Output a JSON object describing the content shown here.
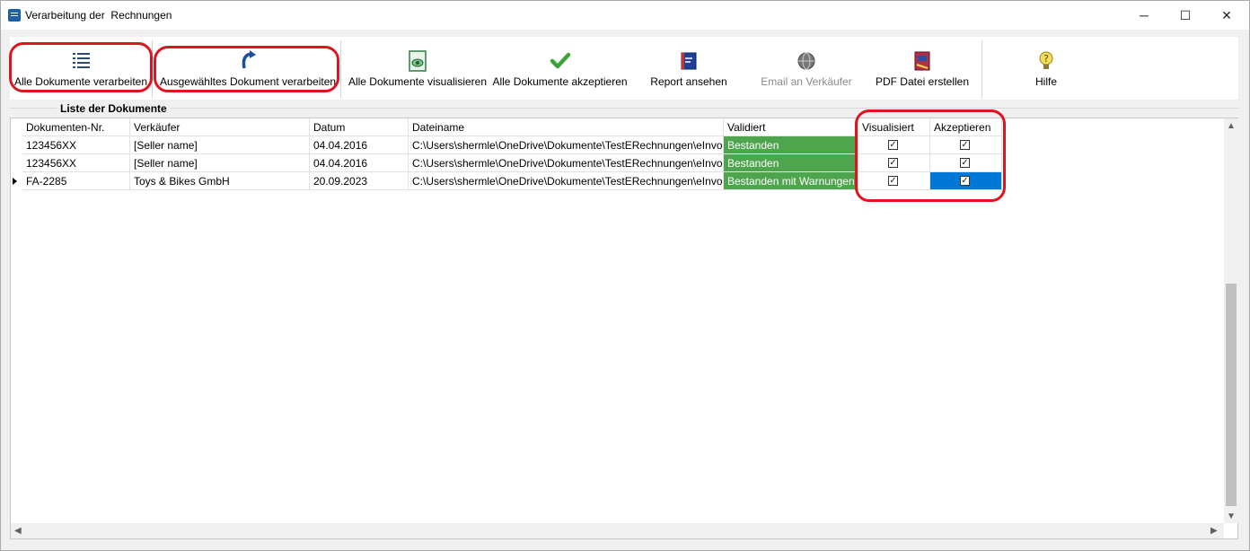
{
  "window": {
    "title": "Verarbeitung der  Rechnungen",
    "minimize": "─",
    "maximize": "☐",
    "close": "✕"
  },
  "toolbar": {
    "process_all": "Alle Dokumente verarbeiten",
    "process_selected": "Ausgewähltes Dokument verarbeiten",
    "visualize_all": "Alle Dokumente visualisieren",
    "accept_all": "Alle Dokumente akzeptieren",
    "report": "Report ansehen",
    "email": "Email an Verkäufer",
    "pdf": "PDF Datei erstellen",
    "help": "Hilfe"
  },
  "group": {
    "label": "Liste der Dokumente"
  },
  "columns": [
    "Dokumenten-Nr.",
    "Verkäufer",
    "Datum",
    "Dateiname",
    "Validiert",
    "Visualisiert",
    "Akzeptieren"
  ],
  "rows": [
    {
      "nr": "123456XX",
      "seller": "[Seller name]",
      "date": "04.04.2016",
      "file": "C:\\Users\\shermle\\OneDrive\\Dokumente\\TestERechnungen\\eInvoi",
      "valid": "Bestanden",
      "visualized": true,
      "accept": true
    },
    {
      "nr": "123456XX",
      "seller": "[Seller name]",
      "date": "04.04.2016",
      "file": "C:\\Users\\shermle\\OneDrive\\Dokumente\\TestERechnungen\\eInvoi",
      "valid": "Bestanden",
      "visualized": true,
      "accept": true
    },
    {
      "nr": "FA-2285",
      "seller": "Toys & Bikes GmbH",
      "date": "20.09.2023",
      "file": "C:\\Users\\shermle\\OneDrive\\Dokumente\\TestERechnungen\\eInvoi",
      "valid": "Bestanden mit Warnungen",
      "visualized": true,
      "accept": true
    }
  ],
  "icons": {
    "process_all": "list-icon",
    "process_selected": "curved-arrow-icon",
    "visualize_all": "eye-document-icon",
    "accept_all": "checkmark-icon",
    "report": "report-book-icon",
    "email": "globe-icon",
    "pdf": "pdf-icon",
    "help": "question-bulb-icon"
  },
  "colors": {
    "validated_ok": "#4ea54d",
    "selection": "#0078d7",
    "highlight_outline": "#e0141e"
  },
  "checkbox_glyph": "✓",
  "scroll": {
    "up": "▲",
    "down": "▼",
    "left": "◀",
    "right": "▶"
  }
}
